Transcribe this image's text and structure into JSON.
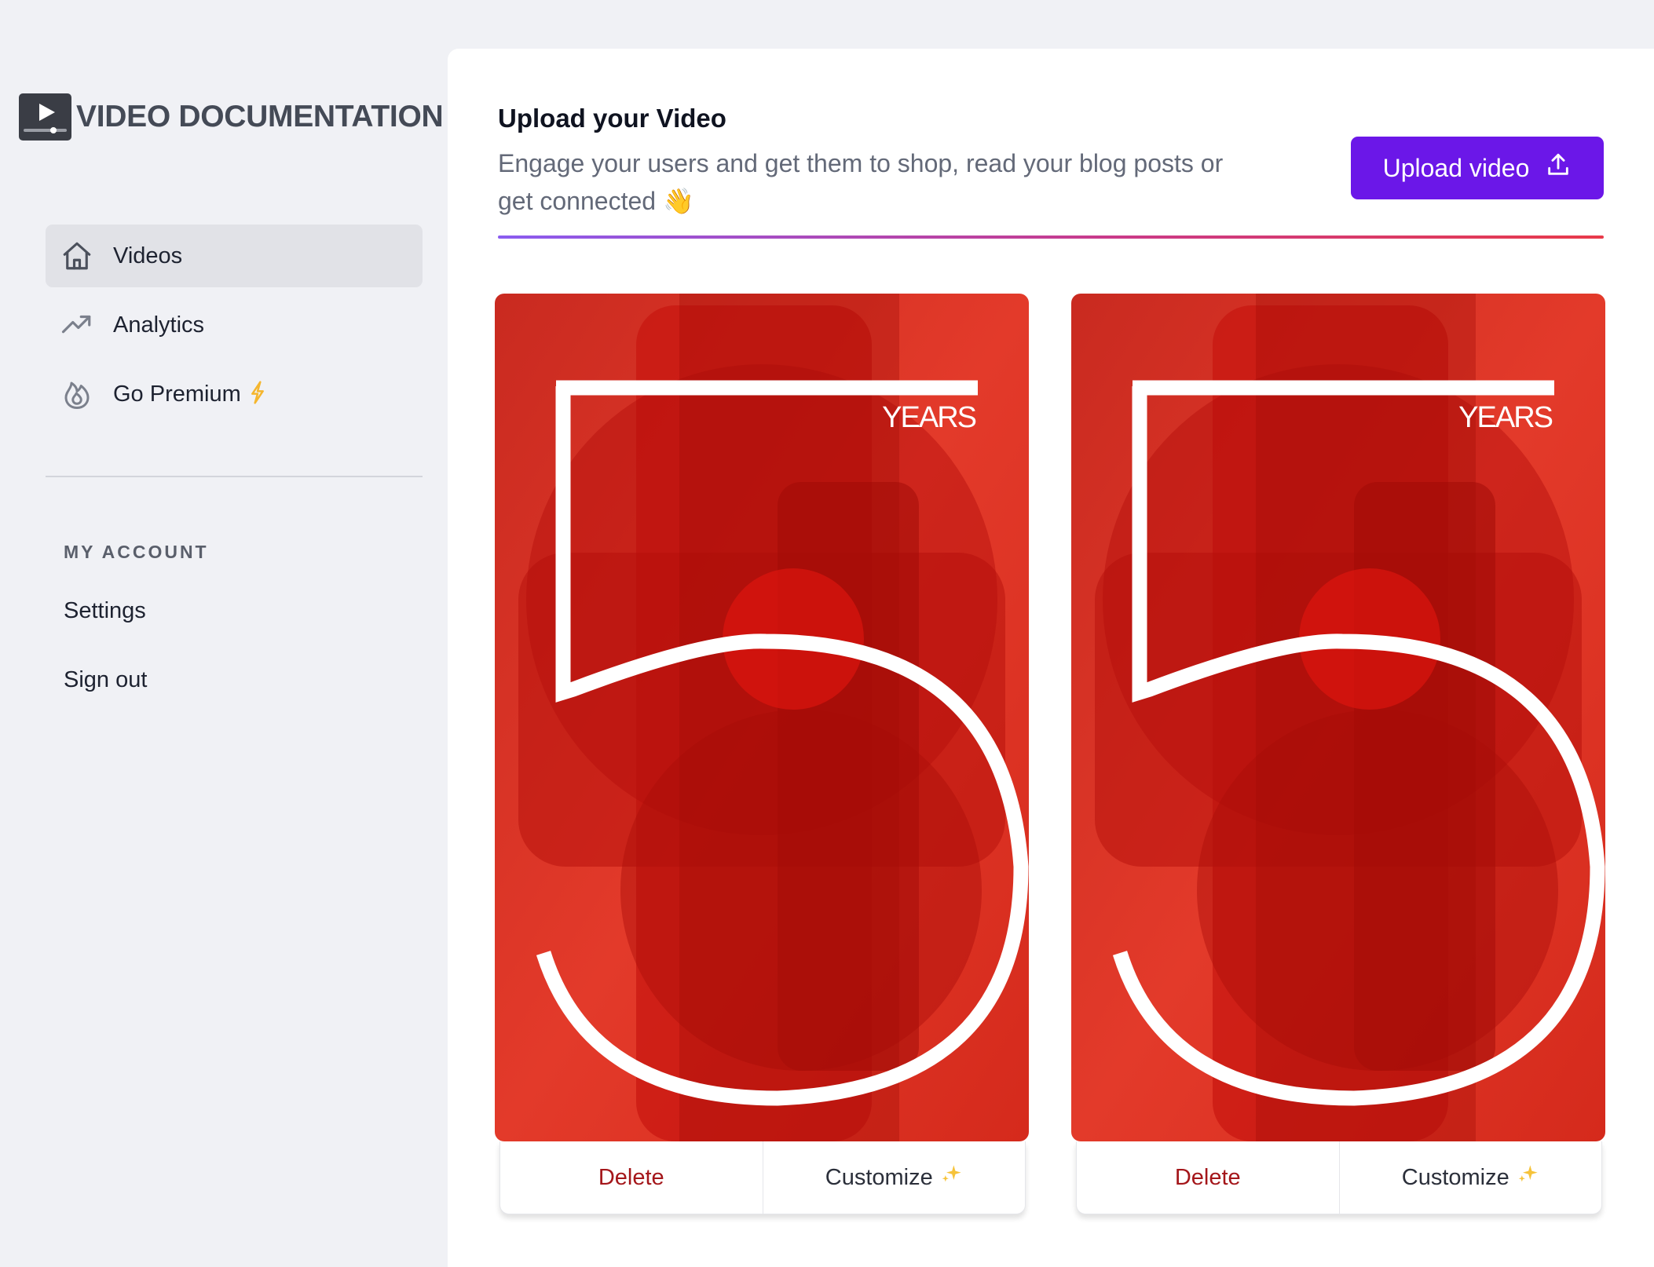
{
  "brand": {
    "name": "VIDEO DOCUMENTATION",
    "logo_icon": "video-player-icon"
  },
  "nav": {
    "items": [
      {
        "label": "Videos",
        "icon": "home-icon",
        "active": true
      },
      {
        "label": "Analytics",
        "icon": "trending-up-icon",
        "active": false
      },
      {
        "label": "Go Premium",
        "icon": "fire-icon",
        "badge_icon": "lightning-icon",
        "active": false
      }
    ]
  },
  "account": {
    "title": "MY ACCOUNT",
    "settings": "Settings",
    "signout": "Sign out"
  },
  "header": {
    "title": "Upload your Video",
    "description": "Engage your users and get them to shop, read your blog posts or get connected 👋",
    "upload_label": "Upload video",
    "upload_icon": "upload-icon"
  },
  "videos": [
    {
      "thumbnail_text": "YEARS",
      "delete_label": "Delete",
      "customize_label": "Customize"
    },
    {
      "thumbnail_text": "YEARS",
      "delete_label": "Delete",
      "customize_label": "Customize"
    }
  ],
  "colors": {
    "accent": "#6b17e8",
    "delete": "#a4161a",
    "sidebar_bg": "#f0f1f5",
    "thumbnail_red": "#d4231b",
    "premium_bolt": "#f5b62e"
  }
}
